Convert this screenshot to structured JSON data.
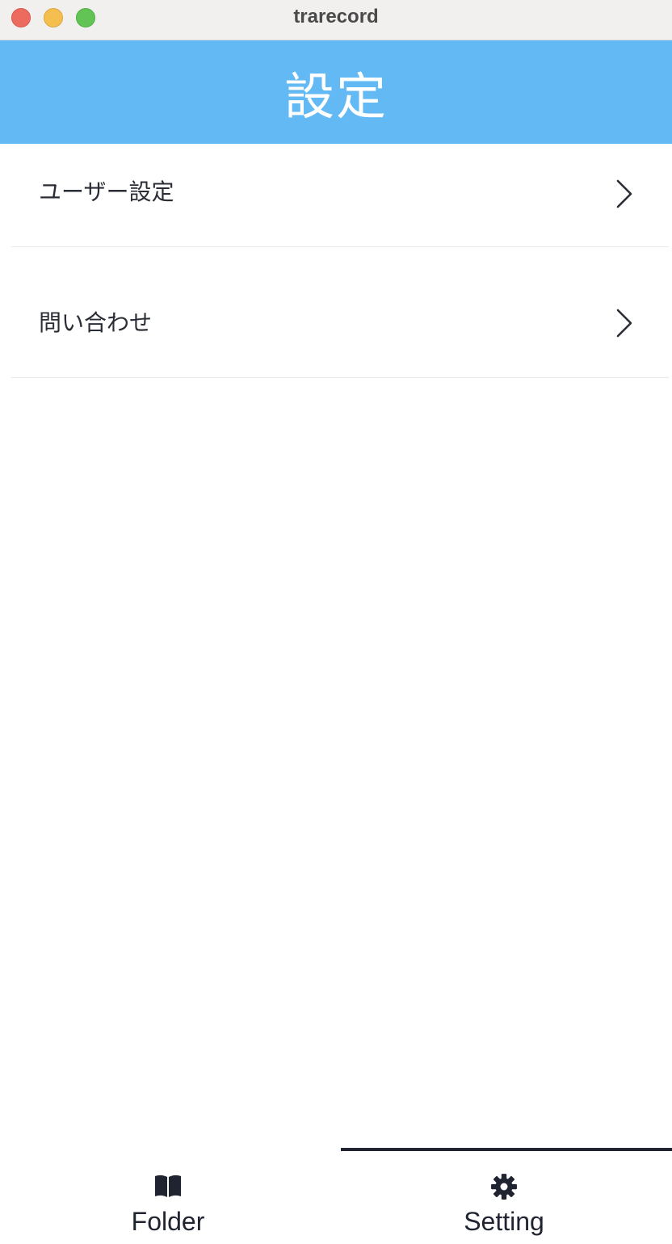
{
  "window": {
    "title": "trarecord"
  },
  "header": {
    "title": "設定"
  },
  "settings_list": {
    "items": [
      {
        "label": "ユーザー設定",
        "icon": "chevron-right-icon"
      },
      {
        "label": "問い合わせ",
        "icon": "chevron-right-icon"
      }
    ]
  },
  "tabbar": {
    "tabs": [
      {
        "label": "Folder",
        "icon": "book-open-icon",
        "active": false
      },
      {
        "label": "Setting",
        "icon": "gear-icon",
        "active": true
      }
    ]
  },
  "colors": {
    "header_bg": "#62b9f3",
    "text": "#2a2d35",
    "tab_active": "#1f2430"
  }
}
